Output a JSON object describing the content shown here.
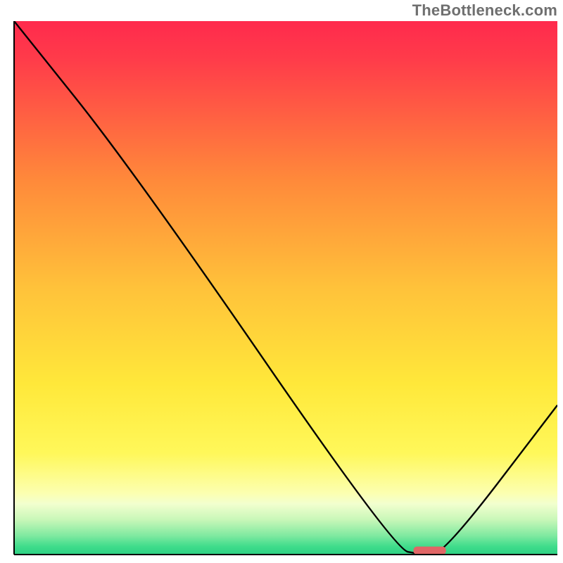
{
  "watermark": "TheBottleneck.com",
  "chart_data": {
    "type": "line",
    "title": "",
    "xlabel": "",
    "ylabel": "",
    "xlim": [
      0,
      100
    ],
    "ylim": [
      0,
      100
    ],
    "x": [
      0,
      22,
      70,
      75,
      79,
      100
    ],
    "values": [
      100,
      72,
      1,
      0,
      0,
      28
    ],
    "marker": {
      "x": 76.5,
      "y": 0,
      "color": "#e06666",
      "width": 6,
      "height": 1.5
    },
    "gradient_stops": [
      {
        "offset": 0.0,
        "color": "#ff2a4d"
      },
      {
        "offset": 0.07,
        "color": "#ff3b4a"
      },
      {
        "offset": 0.3,
        "color": "#ff8a3a"
      },
      {
        "offset": 0.5,
        "color": "#ffc23a"
      },
      {
        "offset": 0.68,
        "color": "#ffe83a"
      },
      {
        "offset": 0.81,
        "color": "#fff85a"
      },
      {
        "offset": 0.885,
        "color": "#fcffb0"
      },
      {
        "offset": 0.905,
        "color": "#f2ffcf"
      },
      {
        "offset": 0.935,
        "color": "#c8f7b8"
      },
      {
        "offset": 0.965,
        "color": "#7ee9a0"
      },
      {
        "offset": 0.985,
        "color": "#3fdc8b"
      },
      {
        "offset": 1.0,
        "color": "#2ed183"
      }
    ],
    "axis_color": "#000000",
    "line_color": "#000000"
  }
}
